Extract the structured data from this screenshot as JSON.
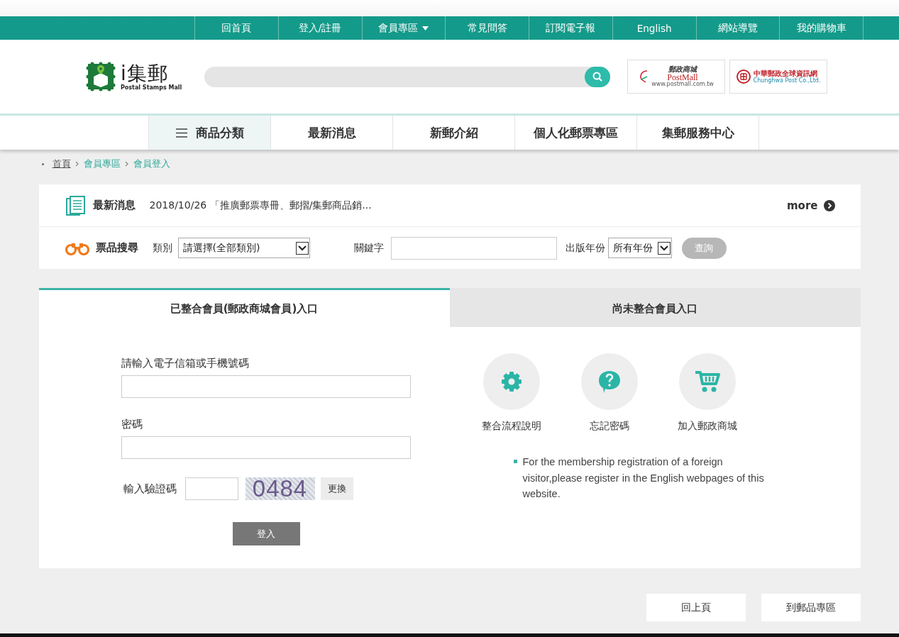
{
  "top_nav": [
    {
      "label": "回首頁",
      "dropdown": false
    },
    {
      "label": "登入/註冊",
      "dropdown": false
    },
    {
      "label": "會員專區",
      "dropdown": true
    },
    {
      "label": "常見問答",
      "dropdown": false
    },
    {
      "label": "訂閱電子報",
      "dropdown": false
    },
    {
      "label": "English",
      "dropdown": false
    },
    {
      "label": "網站導覽",
      "dropdown": false
    },
    {
      "label": "我的購物車",
      "dropdown": false
    }
  ],
  "header": {
    "logo": {
      "title": "i集郵",
      "subtitle": "Postal Stamps Mall"
    },
    "partner_logos": [
      {
        "kind": "postmall",
        "name": "郵政商城",
        "wordmark": "PostMall",
        "url": "www.postmall.com.tw"
      },
      {
        "kind": "chunghwa",
        "name": "中華郵政全球資訊網",
        "subtitle": "Chunghwa Post Co.,Ltd."
      }
    ]
  },
  "main_nav": [
    {
      "label": "商品分類",
      "selected": true
    },
    {
      "label": "最新消息",
      "selected": false
    },
    {
      "label": "新郵介紹",
      "selected": false
    },
    {
      "label": "個人化郵票專區",
      "selected": false
    },
    {
      "label": "集郵服務中心",
      "selected": false
    }
  ],
  "breadcrumb": [
    {
      "label": "首頁",
      "kind": "home"
    },
    {
      "label": "會員專區",
      "kind": "link"
    },
    {
      "label": "會員登入",
      "kind": "link"
    }
  ],
  "news": {
    "label": "最新消息",
    "text": "2018/10/26 「推廣郵票專冊、郵摺/集郵商品銷...",
    "more": "more"
  },
  "stamp_search": {
    "label": "票品搜尋",
    "category_label": "類別",
    "category_value": "請選擇(全部類別)",
    "keyword_label": "關鍵字",
    "year_label": "出版年份",
    "year_value": "所有年份",
    "button": "查詢"
  },
  "login_tabs": [
    {
      "label": "已整合會員(郵政商城會員)入口",
      "selected": true
    },
    {
      "label": "尚未整合會員入口",
      "selected": false
    }
  ],
  "login_form": {
    "email_label": "請輸入電子信箱或手機號碼",
    "password_label": "密碼",
    "captcha_label": "輸入驗證碼",
    "captcha": "0484",
    "refresh_button": "更換",
    "submit": "登入"
  },
  "member_links": [
    {
      "kind": "gear",
      "label": "整合流程說明"
    },
    {
      "kind": "help",
      "label": "忘記密碼"
    },
    {
      "kind": "cart",
      "label": "加入郵政商城"
    }
  ],
  "notice": "For the membership registration of a foreign visitor,please register in the English webpages of this website.",
  "footer_buttons": [
    "回上頁",
    "到郵品專區"
  ]
}
